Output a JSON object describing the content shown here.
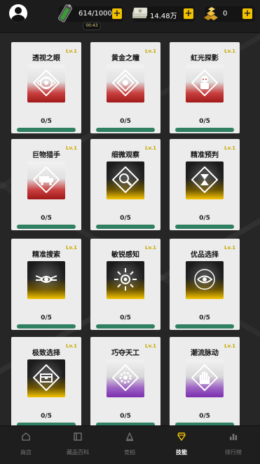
{
  "topbar": {
    "energy": {
      "value": "614/1000",
      "icon": "battery-icon"
    },
    "timer": "00:43",
    "cash": {
      "value": "14.48万",
      "icon": "cash-icon"
    },
    "gold": {
      "value": "0",
      "icon": "gold-bars-icon"
    },
    "plus_label": "+"
  },
  "skills": [
    {
      "name": "透视之眼",
      "level": "Lv.1",
      "progress": "0/5",
      "fill": 0,
      "rarity": "red",
      "icon": "eye-swirl-icon"
    },
    {
      "name": "黄金之瞳",
      "level": "Lv.1",
      "progress": "0/5",
      "fill": 0,
      "rarity": "red",
      "icon": "golden-eye-icon"
    },
    {
      "name": "虹光探影",
      "level": "Lv.1",
      "progress": "0/5",
      "fill": 0,
      "rarity": "red",
      "icon": "robot-icon"
    },
    {
      "name": "巨物猎手",
      "level": "Lv.1",
      "progress": "0/5",
      "fill": 0,
      "rarity": "red",
      "icon": "truck-icon"
    },
    {
      "name": "细微观察",
      "level": "Lv.1",
      "progress": "0/5",
      "fill": 0,
      "rarity": "gold",
      "icon": "magnifier-icon"
    },
    {
      "name": "精准预判",
      "level": "Lv.1",
      "progress": "0/5",
      "fill": 0,
      "rarity": "gold",
      "icon": "hourglass-icon"
    },
    {
      "name": "精准搜索",
      "level": "Lv.1",
      "progress": "0/5",
      "fill": 0,
      "rarity": "gold",
      "icon": "winged-eye-icon"
    },
    {
      "name": "敏锐感知",
      "level": "Lv.1",
      "progress": "0/5",
      "fill": 0,
      "rarity": "gold",
      "icon": "radiating-eye-icon"
    },
    {
      "name": "优品选择",
      "level": "Lv.1",
      "progress": "0/5",
      "fill": 0,
      "rarity": "gold",
      "icon": "eye-target-icon"
    },
    {
      "name": "极致选择",
      "level": "Lv.1",
      "progress": "0/5",
      "fill": 0,
      "rarity": "gold",
      "icon": "chest-icon"
    },
    {
      "name": "巧夺天工",
      "level": "Lv.1",
      "progress": "0/5",
      "fill": 0,
      "rarity": "purple",
      "icon": "gear-badge-icon"
    },
    {
      "name": "潮流脉动",
      "level": "Lv.1",
      "progress": "0/5",
      "fill": 0,
      "rarity": "purple",
      "icon": "hand-icon"
    }
  ],
  "nav": [
    {
      "label": "商店",
      "icon": "shop-icon",
      "active": false
    },
    {
      "label": "藏品百科",
      "icon": "book-icon",
      "active": false
    },
    {
      "label": "竞拍",
      "icon": "gavel-icon",
      "active": false
    },
    {
      "label": "技能",
      "icon": "skill-icon",
      "active": true
    },
    {
      "label": "排行榜",
      "icon": "leaderboard-icon",
      "active": false
    }
  ],
  "colors": {
    "accent": "#f2c200",
    "progress": "#3aa27a",
    "level": "#c9a800"
  }
}
